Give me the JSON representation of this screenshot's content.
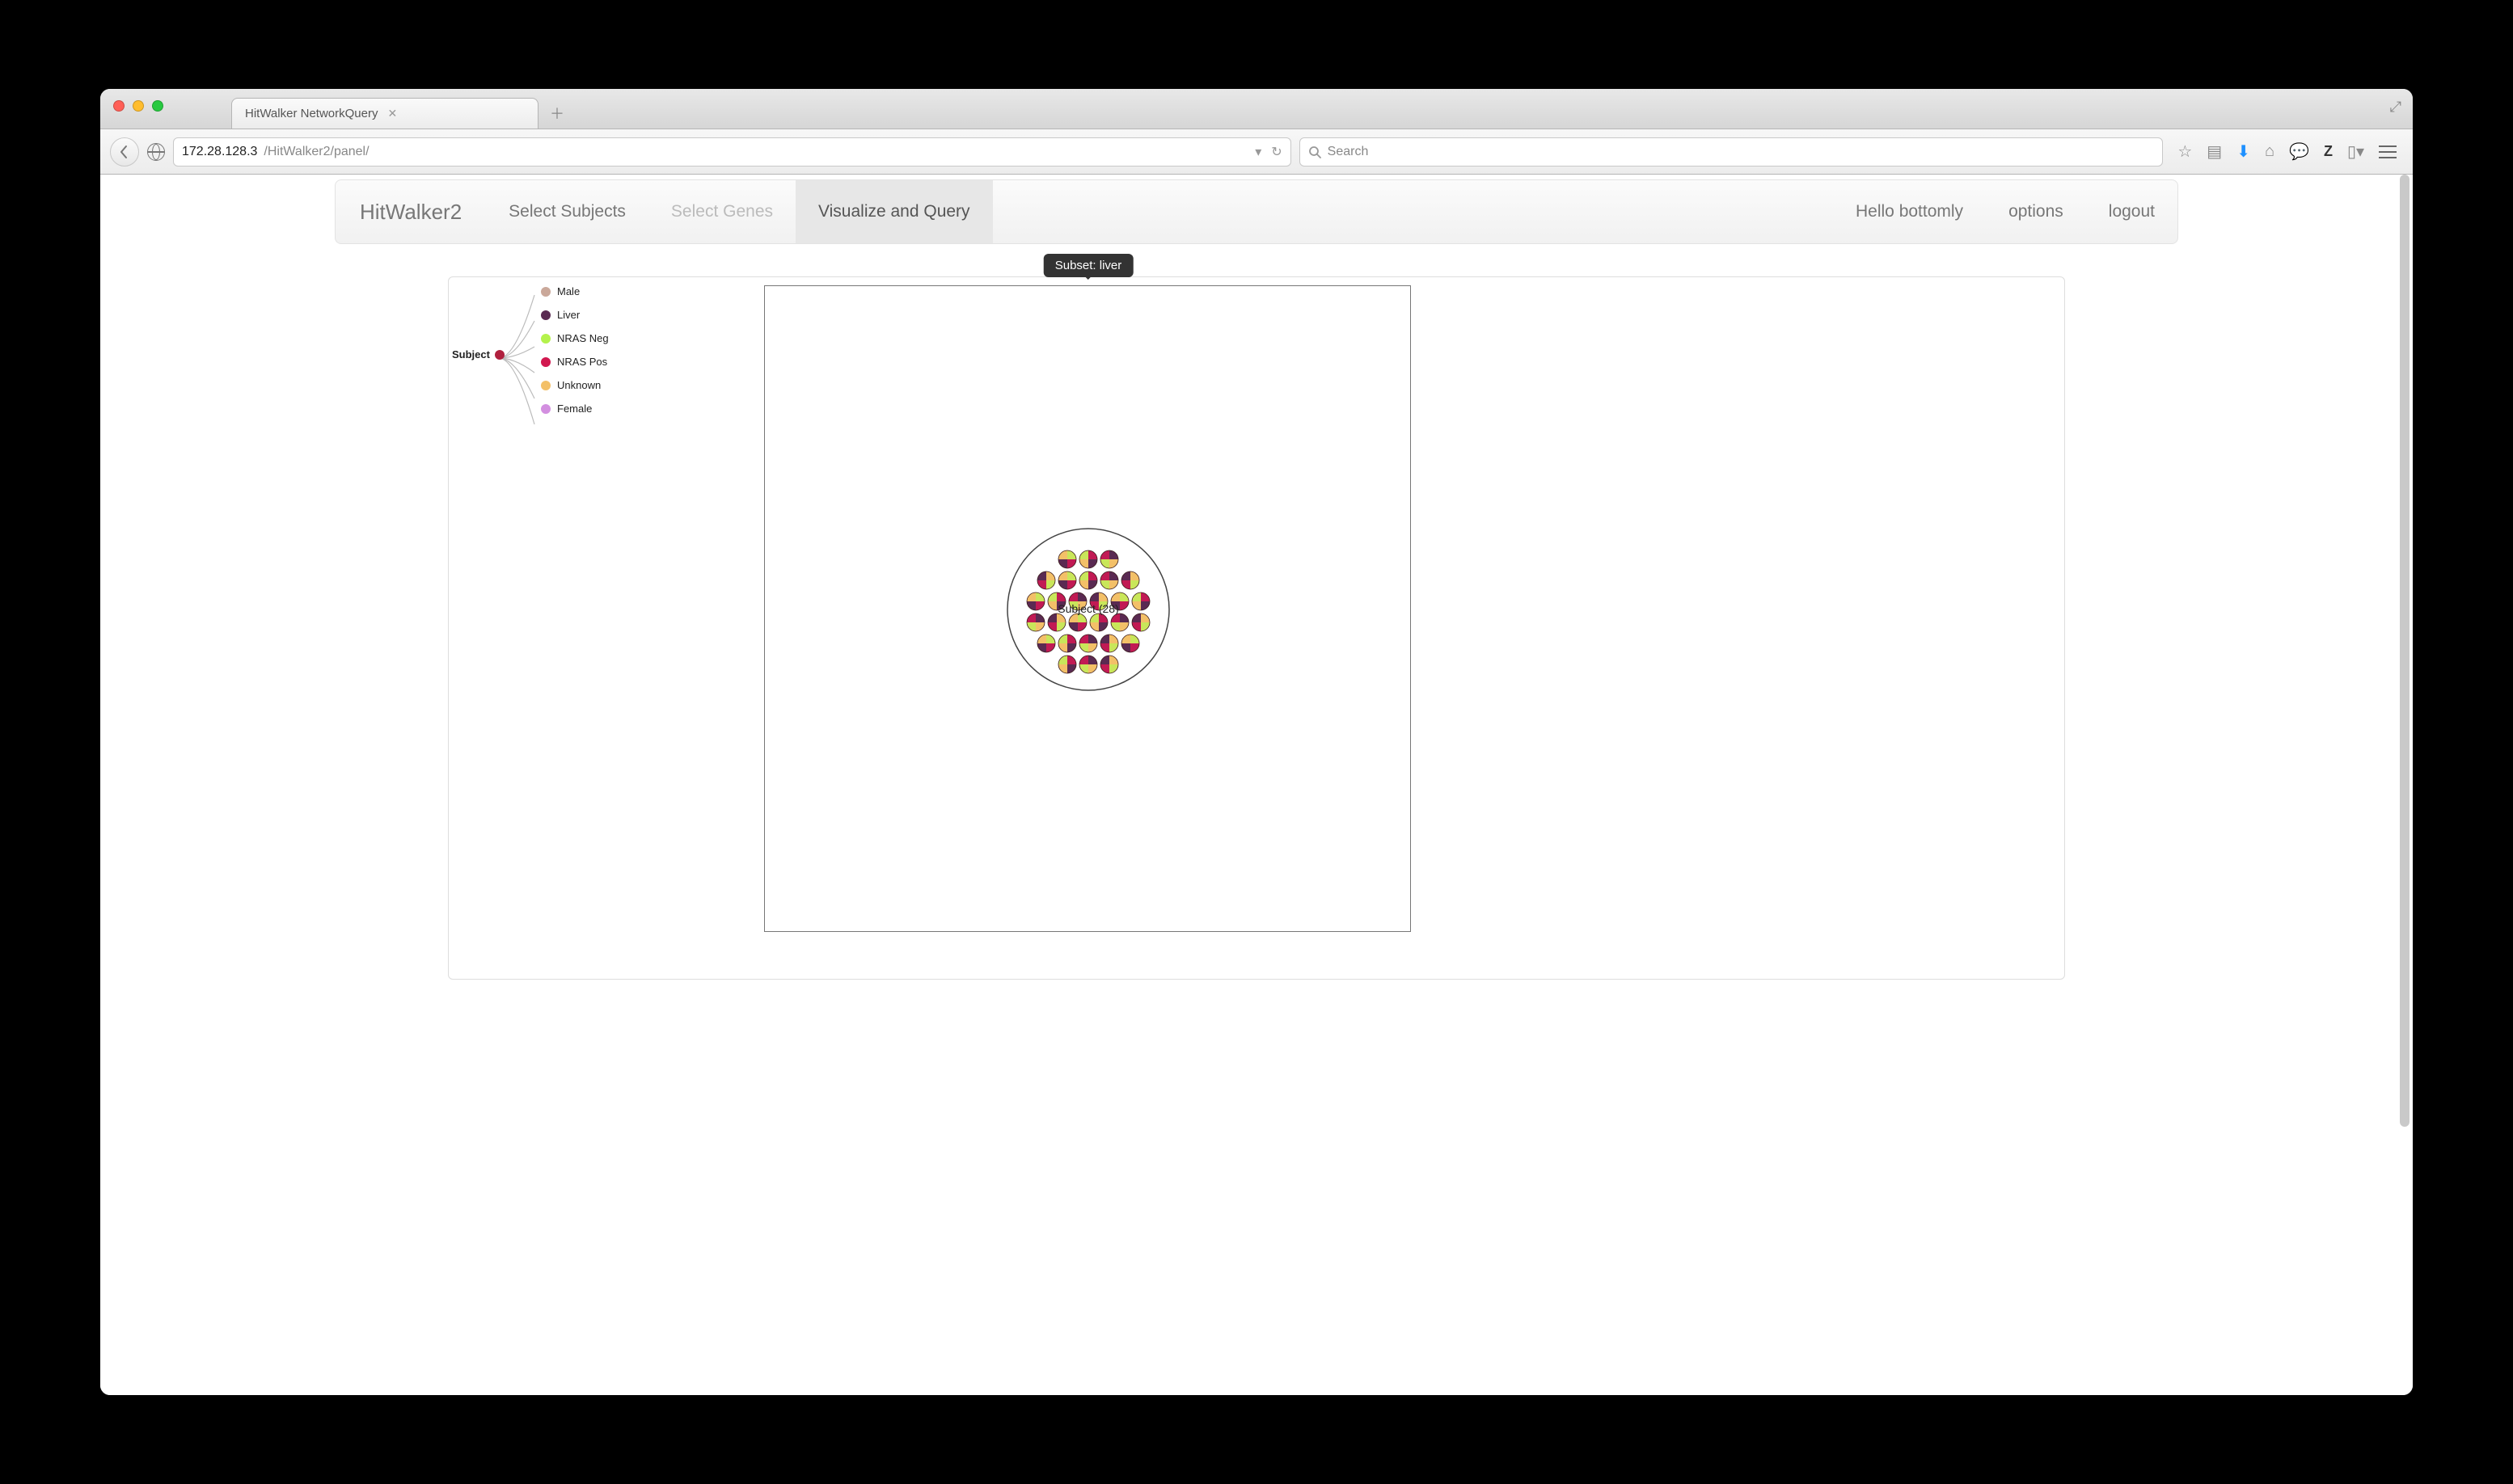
{
  "browser": {
    "tab_title": "HitWalker NetworkQuery",
    "url_host": "172.28.128.3",
    "url_path": "/HitWalker2/panel/",
    "search_placeholder": "Search"
  },
  "app_nav": {
    "brand": "HitWalker2",
    "items": [
      {
        "label": "Select Subjects",
        "state": "normal"
      },
      {
        "label": "Select Genes",
        "state": "disabled"
      },
      {
        "label": "Visualize and Query",
        "state": "active"
      }
    ],
    "right": {
      "greeting": "Hello bottomly",
      "options": "options",
      "logout": "logout"
    }
  },
  "tooltip": "Subset: liver",
  "legend": {
    "root_label": "Subject",
    "root_color": "#b0203e",
    "items": [
      {
        "label": "Male",
        "color": "#caa89a"
      },
      {
        "label": "Liver",
        "color": "#5a2a52"
      },
      {
        "label": "NRAS Neg",
        "color": "#b4f24c"
      },
      {
        "label": "NRAS Pos",
        "color": "#d1184f"
      },
      {
        "label": "Unknown",
        "color": "#f3c068"
      },
      {
        "label": "Female",
        "color": "#d38fe0"
      }
    ]
  },
  "viz": {
    "cluster_label": "Subject (28)",
    "cluster_count": 28
  },
  "colors": {
    "pie_a": "#c9e65a",
    "pie_b": "#c11a54",
    "pie_c": "#5a2a52",
    "pie_d": "#f3c068"
  }
}
